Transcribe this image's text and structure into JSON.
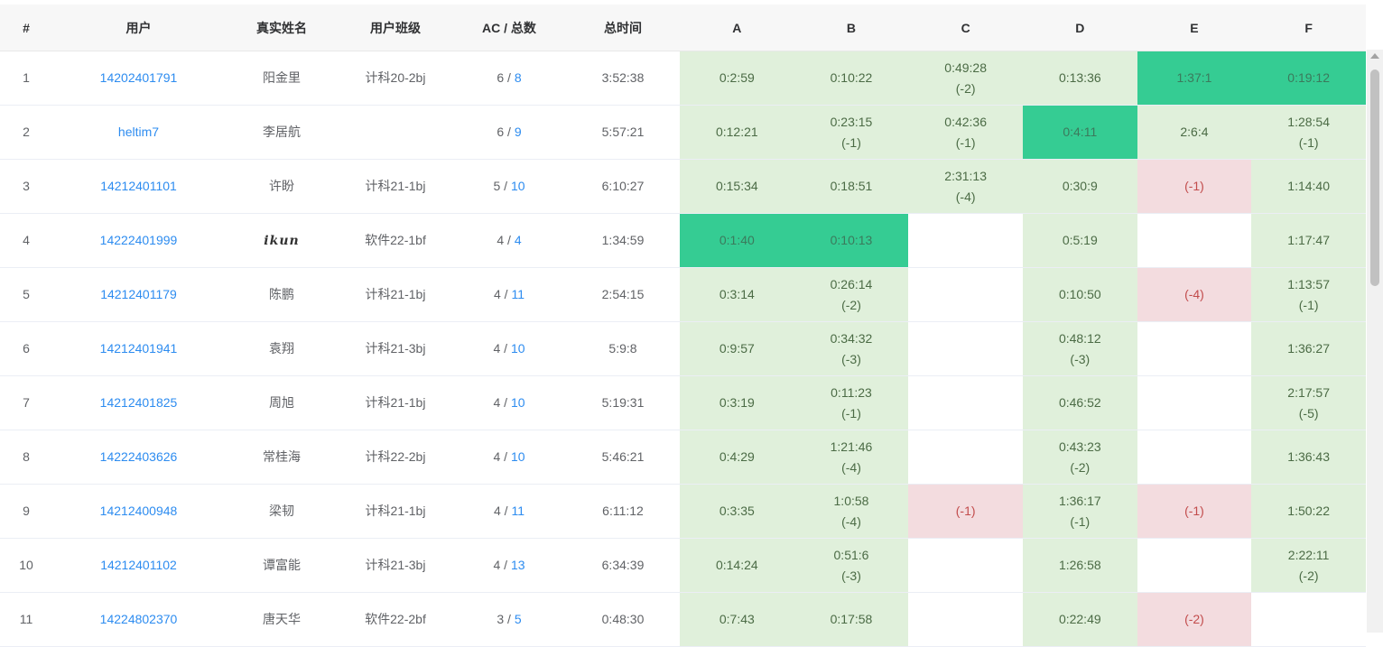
{
  "headers": {
    "rank": "#",
    "user": "用户",
    "realname": "真实姓名",
    "class": "用户班级",
    "ac": "AC / 总数",
    "time": "总时间",
    "problems": [
      "A",
      "B",
      "C",
      "D",
      "E",
      "F"
    ]
  },
  "rows": [
    {
      "rank": "1",
      "user": "14202401791",
      "realname": "阳金里",
      "class": "计科20-2bj",
      "ac": "6",
      "total": "8",
      "time": "3:52:38",
      "cells": [
        {
          "s": "ac",
          "t": "0:2:59",
          "p": ""
        },
        {
          "s": "ac",
          "t": "0:10:22",
          "p": ""
        },
        {
          "s": "ac",
          "t": "0:49:28",
          "p": "(-2)"
        },
        {
          "s": "ac",
          "t": "0:13:36",
          "p": ""
        },
        {
          "s": "first",
          "t": "1:37:1",
          "p": ""
        },
        {
          "s": "first",
          "t": "0:19:12",
          "p": ""
        }
      ]
    },
    {
      "rank": "2",
      "user": "heltim7",
      "realname": "李居航",
      "class": "",
      "ac": "6",
      "total": "9",
      "time": "5:57:21",
      "cells": [
        {
          "s": "ac",
          "t": "0:12:21",
          "p": ""
        },
        {
          "s": "ac",
          "t": "0:23:15",
          "p": "(-1)"
        },
        {
          "s": "ac",
          "t": "0:42:36",
          "p": "(-1)"
        },
        {
          "s": "first",
          "t": "0:4:11",
          "p": ""
        },
        {
          "s": "ac",
          "t": "2:6:4",
          "p": ""
        },
        {
          "s": "ac",
          "t": "1:28:54",
          "p": "(-1)"
        }
      ]
    },
    {
      "rank": "3",
      "user": "14212401101",
      "realname": "许盼",
      "class": "计科21-1bj",
      "ac": "5",
      "total": "10",
      "time": "6:10:27",
      "cells": [
        {
          "s": "ac",
          "t": "0:15:34",
          "p": ""
        },
        {
          "s": "ac",
          "t": "0:18:51",
          "p": ""
        },
        {
          "s": "ac",
          "t": "2:31:13",
          "p": "(-4)"
        },
        {
          "s": "ac",
          "t": "0:30:9",
          "p": ""
        },
        {
          "s": "wa",
          "t": "",
          "p": "(-1)"
        },
        {
          "s": "ac",
          "t": "1:14:40",
          "p": ""
        }
      ]
    },
    {
      "rank": "4",
      "user": "14222401999",
      "realname": "ikun",
      "class": "软件22-1bf",
      "ac": "4",
      "total": "4",
      "time": "1:34:59",
      "cells": [
        {
          "s": "first",
          "t": "0:1:40",
          "p": ""
        },
        {
          "s": "first",
          "t": "0:10:13",
          "p": ""
        },
        {
          "s": "none",
          "t": "",
          "p": ""
        },
        {
          "s": "ac",
          "t": "0:5:19",
          "p": ""
        },
        {
          "s": "none",
          "t": "",
          "p": ""
        },
        {
          "s": "ac",
          "t": "1:17:47",
          "p": ""
        }
      ]
    },
    {
      "rank": "5",
      "user": "14212401179",
      "realname": "陈鹏",
      "class": "计科21-1bj",
      "ac": "4",
      "total": "11",
      "time": "2:54:15",
      "cells": [
        {
          "s": "ac",
          "t": "0:3:14",
          "p": ""
        },
        {
          "s": "ac",
          "t": "0:26:14",
          "p": "(-2)"
        },
        {
          "s": "none",
          "t": "",
          "p": ""
        },
        {
          "s": "ac",
          "t": "0:10:50",
          "p": ""
        },
        {
          "s": "wa",
          "t": "",
          "p": "(-4)"
        },
        {
          "s": "ac",
          "t": "1:13:57",
          "p": "(-1)"
        }
      ]
    },
    {
      "rank": "6",
      "user": "14212401941",
      "realname": "袁翔",
      "class": "计科21-3bj",
      "ac": "4",
      "total": "10",
      "time": "5:9:8",
      "cells": [
        {
          "s": "ac",
          "t": "0:9:57",
          "p": ""
        },
        {
          "s": "ac",
          "t": "0:34:32",
          "p": "(-3)"
        },
        {
          "s": "none",
          "t": "",
          "p": ""
        },
        {
          "s": "ac",
          "t": "0:48:12",
          "p": "(-3)"
        },
        {
          "s": "none",
          "t": "",
          "p": ""
        },
        {
          "s": "ac",
          "t": "1:36:27",
          "p": ""
        }
      ]
    },
    {
      "rank": "7",
      "user": "14212401825",
      "realname": "周旭",
      "class": "计科21-1bj",
      "ac": "4",
      "total": "10",
      "time": "5:19:31",
      "cells": [
        {
          "s": "ac",
          "t": "0:3:19",
          "p": ""
        },
        {
          "s": "ac",
          "t": "0:11:23",
          "p": "(-1)"
        },
        {
          "s": "none",
          "t": "",
          "p": ""
        },
        {
          "s": "ac",
          "t": "0:46:52",
          "p": ""
        },
        {
          "s": "none",
          "t": "",
          "p": ""
        },
        {
          "s": "ac",
          "t": "2:17:57",
          "p": "(-5)"
        }
      ]
    },
    {
      "rank": "8",
      "user": "14222403626",
      "realname": "常桂海",
      "class": "计科22-2bj",
      "ac": "4",
      "total": "10",
      "time": "5:46:21",
      "cells": [
        {
          "s": "ac",
          "t": "0:4:29",
          "p": ""
        },
        {
          "s": "ac",
          "t": "1:21:46",
          "p": "(-4)"
        },
        {
          "s": "none",
          "t": "",
          "p": ""
        },
        {
          "s": "ac",
          "t": "0:43:23",
          "p": "(-2)"
        },
        {
          "s": "none",
          "t": "",
          "p": ""
        },
        {
          "s": "ac",
          "t": "1:36:43",
          "p": ""
        }
      ]
    },
    {
      "rank": "9",
      "user": "14212400948",
      "realname": "梁韧",
      "class": "计科21-1bj",
      "ac": "4",
      "total": "11",
      "time": "6:11:12",
      "cells": [
        {
          "s": "ac",
          "t": "0:3:35",
          "p": ""
        },
        {
          "s": "ac",
          "t": "1:0:58",
          "p": "(-4)"
        },
        {
          "s": "wa",
          "t": "",
          "p": "(-1)"
        },
        {
          "s": "ac",
          "t": "1:36:17",
          "p": "(-1)"
        },
        {
          "s": "wa",
          "t": "",
          "p": "(-1)"
        },
        {
          "s": "ac",
          "t": "1:50:22",
          "p": ""
        }
      ]
    },
    {
      "rank": "10",
      "user": "14212401102",
      "realname": "谭富能",
      "class": "计科21-3bj",
      "ac": "4",
      "total": "13",
      "time": "6:34:39",
      "cells": [
        {
          "s": "ac",
          "t": "0:14:24",
          "p": ""
        },
        {
          "s": "ac",
          "t": "0:51:6",
          "p": "(-3)"
        },
        {
          "s": "none",
          "t": "",
          "p": ""
        },
        {
          "s": "ac",
          "t": "1:26:58",
          "p": ""
        },
        {
          "s": "none",
          "t": "",
          "p": ""
        },
        {
          "s": "ac",
          "t": "2:22:11",
          "p": "(-2)"
        }
      ]
    },
    {
      "rank": "11",
      "user": "14224802370",
      "realname": "唐天华",
      "class": "软件22-2bf",
      "ac": "3",
      "total": "5",
      "time": "0:48:30",
      "cells": [
        {
          "s": "ac",
          "t": "0:7:43",
          "p": ""
        },
        {
          "s": "ac",
          "t": "0:17:58",
          "p": ""
        },
        {
          "s": "none",
          "t": "",
          "p": ""
        },
        {
          "s": "ac",
          "t": "0:22:49",
          "p": ""
        },
        {
          "s": "wa",
          "t": "",
          "p": "(-2)"
        },
        {
          "s": "none",
          "t": "",
          "p": ""
        }
      ]
    }
  ]
}
